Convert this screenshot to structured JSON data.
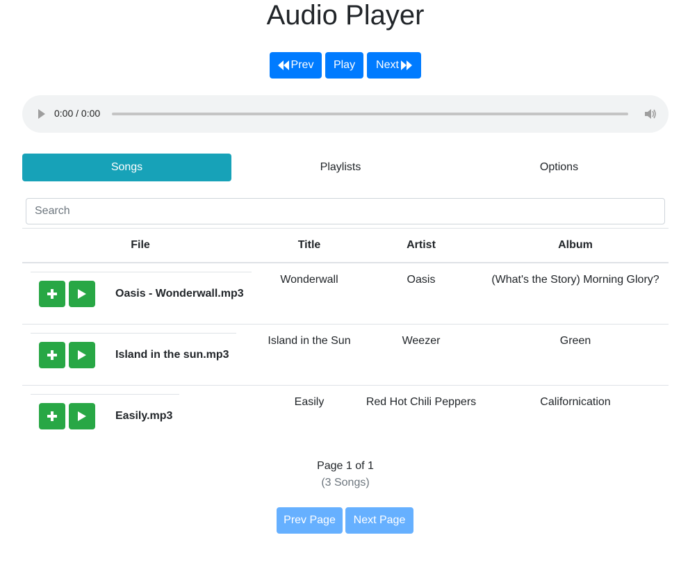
{
  "header": {
    "title": "Audio Player"
  },
  "controls": {
    "prev_label": "Prev",
    "play_label": "Play",
    "next_label": "Next"
  },
  "audio": {
    "time": "0:00 / 0:00"
  },
  "tabs": [
    {
      "label": "Songs",
      "active": true
    },
    {
      "label": "Playlists",
      "active": false
    },
    {
      "label": "Options",
      "active": false
    }
  ],
  "search": {
    "placeholder": "Search",
    "value": ""
  },
  "table": {
    "headers": {
      "file": "File",
      "title": "Title",
      "artist": "Artist",
      "album": "Album"
    },
    "rows": [
      {
        "file": "Oasis - Wonderwall.mp3",
        "title": "Wonderwall",
        "artist": "Oasis",
        "album": "(What's the Story) Morning Glory?"
      },
      {
        "file": "Island in the sun.mp3",
        "title": "Island in the Sun",
        "artist": "Weezer",
        "album": "Green"
      },
      {
        "file": "Easily.mp3",
        "title": "Easily",
        "artist": "Red Hot Chili Peppers",
        "album": "Californication"
      }
    ]
  },
  "pagination": {
    "page_info": "Page 1 of 1",
    "count": "(3 Songs)",
    "prev_label": "Prev Page",
    "next_label": "Next Page"
  },
  "colors": {
    "primary": "#007bff",
    "success": "#28a745",
    "info": "#17a2b8",
    "disabled_primary": "#66b0ff"
  },
  "icons": {
    "prev": "backward-icon",
    "next": "forward-icon",
    "add": "plus-icon",
    "play": "play-icon",
    "volume": "volume-icon"
  }
}
